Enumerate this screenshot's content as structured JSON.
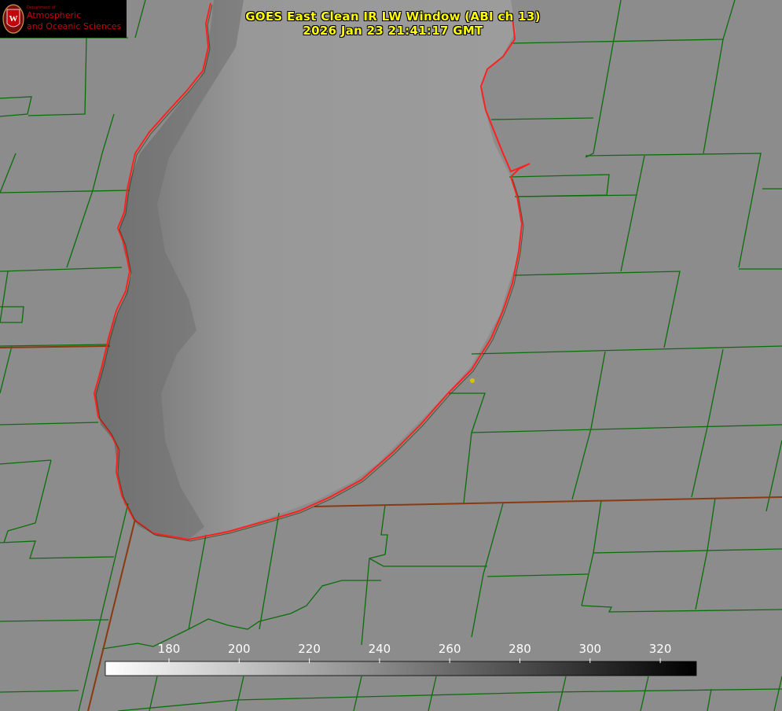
{
  "logo": {
    "department": "Department of",
    "line1": "Atmospheric",
    "line2": "and Oceanic Sciences",
    "seal_letter": "W"
  },
  "title": {
    "line1": "GOES East Clean IR LW Window (ABI ch 13)",
    "line2": "2026 Jan 23 21:41:17 GMT"
  },
  "colorbar": {
    "ticks": [
      "180",
      "200",
      "220",
      "240",
      "260",
      "280",
      "300",
      "320"
    ],
    "gradient": [
      "#ffffff",
      "#000000"
    ]
  },
  "colors": {
    "land": "#8a8a8a",
    "lake": "#9b9b9b",
    "shore_dark": "#6e6e6e",
    "boundaries": "#0a6e0a",
    "coastline": "#ff2020",
    "state_line": "#8a3a10",
    "title": "#ffff00",
    "marker": "#d4c400"
  }
}
